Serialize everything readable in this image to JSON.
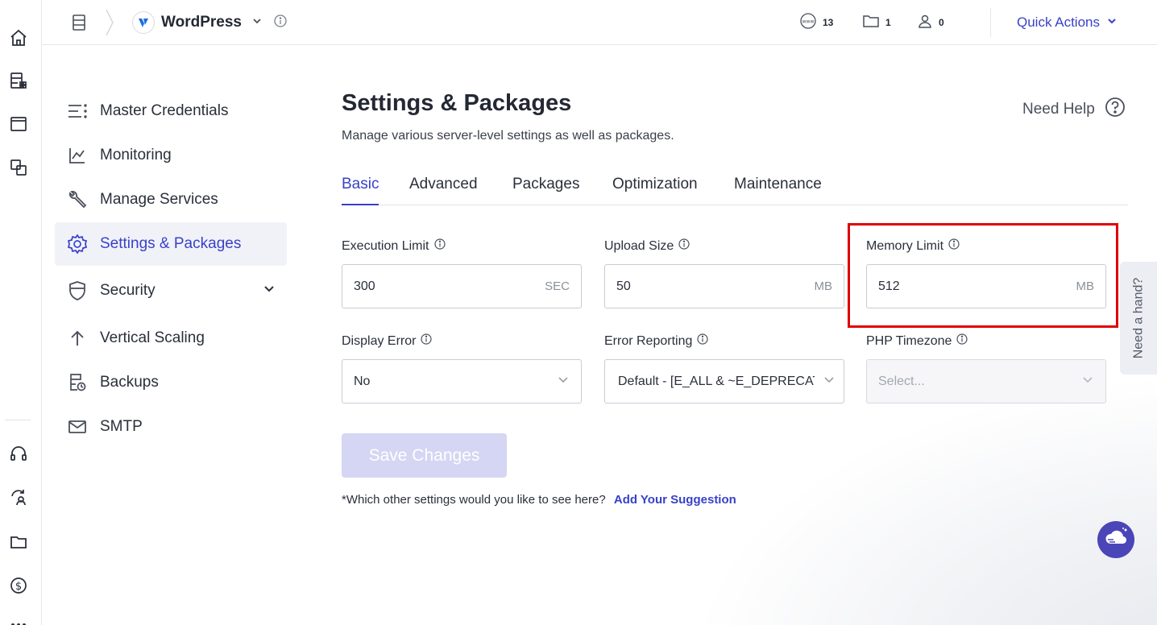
{
  "topbar": {
    "app_name": "WordPress",
    "stats": [
      {
        "icon": "www-icon",
        "count": "13"
      },
      {
        "icon": "folder-icon",
        "count": "1"
      },
      {
        "icon": "user-icon",
        "count": "0"
      }
    ],
    "quick_actions": "Quick Actions"
  },
  "subnav": {
    "items": [
      {
        "label": "Master Credentials",
        "icon": "list-icon"
      },
      {
        "label": "Monitoring",
        "icon": "chart-line-icon"
      },
      {
        "label": "Manage Services",
        "icon": "wrench-icon"
      },
      {
        "label": "Settings & Packages",
        "icon": "gear-icon",
        "active": true
      },
      {
        "label": "Security",
        "icon": "shield-icon"
      },
      {
        "label": "Vertical Scaling",
        "icon": "arrow-up-icon"
      },
      {
        "label": "Backups",
        "icon": "backup-icon"
      },
      {
        "label": "SMTP",
        "icon": "mail-icon"
      }
    ]
  },
  "main": {
    "title": "Settings & Packages",
    "subtitle": "Manage various server-level settings as well as packages.",
    "need_help": "Need Help",
    "tabs": [
      "Basic",
      "Advanced",
      "Packages",
      "Optimization",
      "Maintenance"
    ],
    "active_tab": "Basic",
    "fields": {
      "execution_limit": {
        "label": "Execution Limit",
        "value": "300",
        "unit": "SEC"
      },
      "upload_size": {
        "label": "Upload Size",
        "value": "50",
        "unit": "MB"
      },
      "memory_limit": {
        "label": "Memory Limit",
        "value": "512",
        "unit": "MB"
      },
      "display_error": {
        "label": "Display Error",
        "value": "No"
      },
      "error_reporting": {
        "label": "Error Reporting",
        "value": "Default - [E_ALL & ~E_DEPRECATED"
      },
      "php_timezone": {
        "label": "PHP Timezone",
        "placeholder": "Select..."
      }
    },
    "save_label": "Save Changes",
    "footer_question": "*Which other settings would you like to see here?",
    "footer_link": "Add Your Suggestion"
  },
  "widgets": {
    "need_a_hand": "Need a hand?"
  },
  "colors": {
    "accent": "#3841c9",
    "highlight": "#e00000",
    "save_disabled": "#d4d6f3"
  }
}
